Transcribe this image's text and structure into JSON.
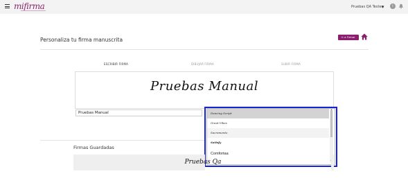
{
  "topbar": {
    "logo_text": "mifirma",
    "user_name": "Pruebas QA Tester",
    "chevron": "▾",
    "info_glyph": "i"
  },
  "header": {
    "title": "Personaliza tu firma manuscrita",
    "ir_a_firmar": "Ir a Firmar"
  },
  "tabs": [
    {
      "label": "ESCRIBIR FIRMA",
      "active": true
    },
    {
      "label": "DIBUJAR FIRMA",
      "active": false
    },
    {
      "label": "SUBIR FIRMA",
      "active": false
    }
  ],
  "preview": {
    "signature_text": "Pruebas Manual"
  },
  "name_input": {
    "value": "Pruebas Manual"
  },
  "font_list": {
    "options": [
      "Dancing Script",
      "Great Vibes",
      "Sacramento",
      "Satisfy",
      "Comfortaa"
    ],
    "selected_index": 0,
    "scroll_up": "▲",
    "scroll_down": "▼"
  },
  "saved": {
    "title": "Firmas Guardadas",
    "signature_text": "Pruebas Qa"
  },
  "colors": {
    "brand": "#8a1f6e",
    "dropdown_highlight": "#1622d8"
  }
}
